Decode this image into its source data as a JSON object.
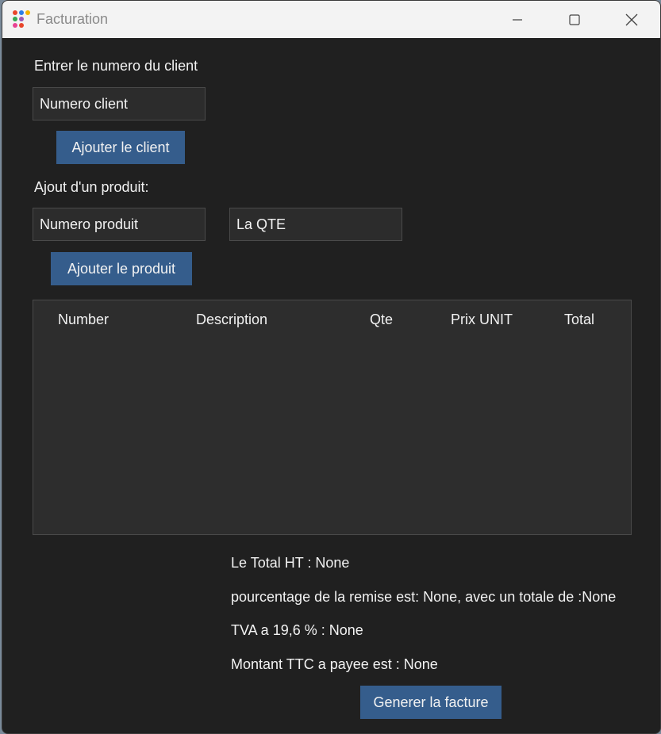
{
  "window": {
    "title": "Facturation",
    "controls": {
      "minimize": "—",
      "maximize": "☐",
      "close": "✕"
    },
    "icon_colors": [
      "#e8462b",
      "#2b7de8",
      "#f4b400",
      "#34a853",
      "#9b59b6",
      "#e84393"
    ]
  },
  "client": {
    "prompt": "Entrer le numero du client",
    "input_value": "Numero client",
    "add_button": "Ajouter le client"
  },
  "product": {
    "prompt": "Ajout d'un produit:",
    "number_value": "Numero produit",
    "qty_value": "La QTE",
    "add_button": "Ajouter le produit"
  },
  "table": {
    "columns": [
      "Number",
      "Description",
      "Qte",
      "Prix UNIT",
      "Total"
    ],
    "rows": []
  },
  "summary": {
    "total_ht": "Le Total HT : None",
    "remise": "pourcentage de la remise est: None, avec un totale de :None",
    "tva": "TVA a 19,6 % : None",
    "ttc": "Montant TTC a payee est : None"
  },
  "generate_button": "Generer la facture",
  "colors": {
    "background": "#202020",
    "button": "#355d8c",
    "field": "#2c2c2c",
    "titlebar": "#f3f3f3"
  }
}
